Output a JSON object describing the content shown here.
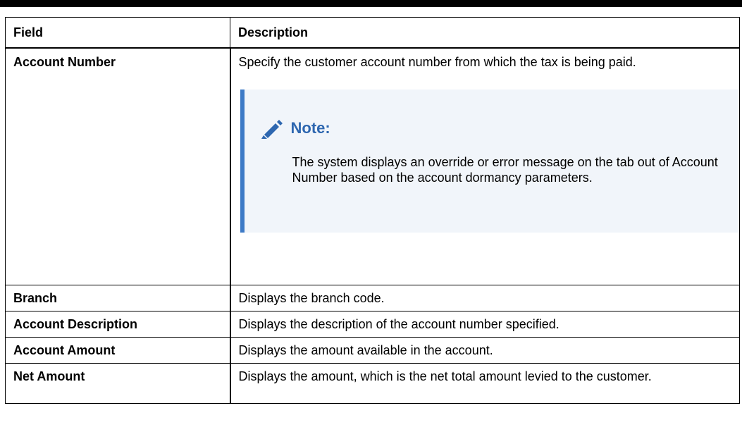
{
  "table": {
    "headers": {
      "field": "Field",
      "description": "Description"
    },
    "rows": [
      {
        "field": "Account Number",
        "description": "Specify the customer account number from which the tax is being paid.",
        "note": {
          "title": "Note:",
          "icon": "pencil-icon",
          "text": "The system displays an override or error message on the tab out of Account Number based on the account dormancy parameters."
        }
      },
      {
        "field": "Branch",
        "description": "Displays the branch code."
      },
      {
        "field": "Account Description",
        "description": "Displays the description of the account number specified."
      },
      {
        "field": "Account Amount",
        "description": "Displays the amount available in the account."
      },
      {
        "field": "Net Amount",
        "description": "Displays the amount, which is the net total amount levied to the customer."
      }
    ]
  },
  "colors": {
    "note_accent": "#3d7ac6",
    "note_background": "#f1f5fa",
    "note_title": "#2e67b0"
  }
}
